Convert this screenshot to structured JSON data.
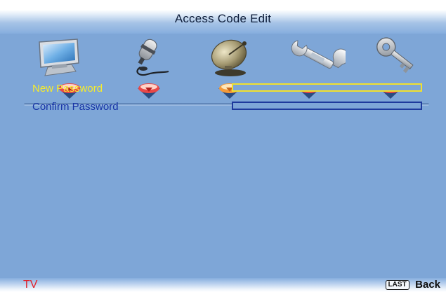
{
  "header": {
    "title": "Access Code Edit"
  },
  "menu_icons": [
    {
      "name": "picture-monitor-icon",
      "active": false
    },
    {
      "name": "audio-microphone-icon",
      "active": false
    },
    {
      "name": "channel-satellite-dish-icon",
      "active": true
    },
    {
      "name": "setup-wrench-icon",
      "active": false
    },
    {
      "name": "lock-key-icon",
      "active": false
    }
  ],
  "form": {
    "new_password_label": "New Password",
    "new_password_value": "",
    "confirm_password_label": "Confirm Password",
    "confirm_password_value": ""
  },
  "footer": {
    "source": "TV",
    "last_key": "LAST",
    "back_label": "Back"
  },
  "colors": {
    "panel_background": "#7ea6d7",
    "selected_label": "#f7ec2a",
    "normal_label": "#1633a6",
    "source_label": "#e0202a",
    "active_marker": "#f39a3a",
    "inactive_marker": "#e84848"
  }
}
